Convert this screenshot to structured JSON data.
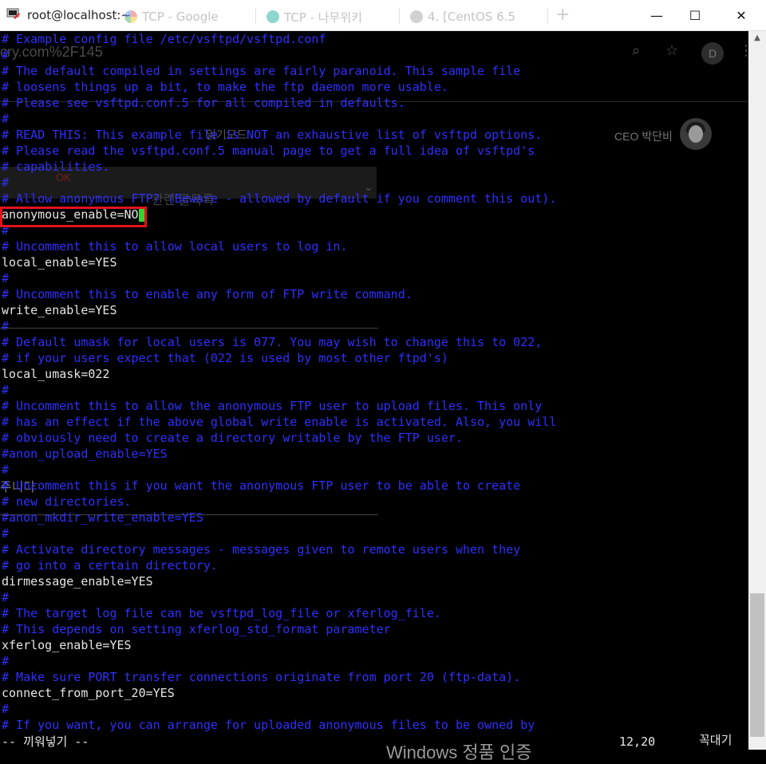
{
  "window": {
    "title": "root@localhost:~",
    "controls": {
      "minimize": "—",
      "maximize": "☐",
      "close": "✕"
    }
  },
  "tabs": [
    {
      "label": "TCP - Google",
      "icon": "google-icon",
      "color": "#4285f4"
    },
    {
      "label": "TCP - 나무위키",
      "icon": "namuwiki-icon",
      "color": "#00a495"
    },
    {
      "label": "4. [CentOS 6.5",
      "icon": "globe-icon",
      "color": "#888888"
    }
  ],
  "newtab_label": "+",
  "browser_ghost": {
    "url_fragment": "cry.com%2F145",
    "toolbar_text": "READ THIS:",
    "mode_text": "읽기모드",
    "user_name": "CEO 박단비",
    "avatar_initial": "D",
    "ok_label": "OK",
    "section_title": "관련 글목록",
    "footer_text": "주니다"
  },
  "terminal": {
    "lines": [
      {
        "text": "# Example config file /etc/vsftpd/vsftpd.conf",
        "kind": "comment"
      },
      {
        "text": "#",
        "kind": "comment"
      },
      {
        "text": "# The default compiled in settings are fairly paranoid. This sample file",
        "kind": "comment"
      },
      {
        "text": "# loosens things up a bit, to make the ftp daemon more usable.",
        "kind": "comment"
      },
      {
        "text": "# Please see vsftpd.conf.5 for all compiled in defaults.",
        "kind": "comment"
      },
      {
        "text": "#",
        "kind": "comment"
      },
      {
        "text": "# READ THIS: This example file is NOT an exhaustive list of vsftpd options.",
        "kind": "comment"
      },
      {
        "text": "# Please read the vsftpd.conf.5 manual page to get a full idea of vsftpd's",
        "kind": "comment"
      },
      {
        "text": "# capabilities.",
        "kind": "comment"
      },
      {
        "text": "#",
        "kind": "comment"
      },
      {
        "text": "# Allow anonymous FTP? (Beware - allowed by default if you comment this out).",
        "kind": "comment"
      },
      {
        "text": "anonymous_enable=NO",
        "kind": "setting",
        "cursor": true
      },
      {
        "text": "#",
        "kind": "comment"
      },
      {
        "text": "# Uncomment this to allow local users to log in.",
        "kind": "comment"
      },
      {
        "text": "local_enable=YES",
        "kind": "setting"
      },
      {
        "text": "#",
        "kind": "comment"
      },
      {
        "text": "# Uncomment this to enable any form of FTP write command.",
        "kind": "comment"
      },
      {
        "text": "write_enable=YES",
        "kind": "setting"
      },
      {
        "text": "#",
        "kind": "comment"
      },
      {
        "text": "# Default umask for local users is 077. You may wish to change this to 022,",
        "kind": "comment"
      },
      {
        "text": "# if your users expect that (022 is used by most other ftpd's)",
        "kind": "comment"
      },
      {
        "text": "local_umask=022",
        "kind": "setting"
      },
      {
        "text": "#",
        "kind": "comment"
      },
      {
        "text": "# Uncomment this to allow the anonymous FTP user to upload files. This only",
        "kind": "comment"
      },
      {
        "text": "# has an effect if the above global write enable is activated. Also, you will",
        "kind": "comment"
      },
      {
        "text": "# obviously need to create a directory writable by the FTP user.",
        "kind": "comment"
      },
      {
        "text": "#anon_upload_enable=YES",
        "kind": "comment"
      },
      {
        "text": "#",
        "kind": "comment"
      },
      {
        "text": "# Uncomment this if you want the anonymous FTP user to be able to create",
        "kind": "comment"
      },
      {
        "text": "# new directories.",
        "kind": "comment"
      },
      {
        "text": "#anon_mkdir_write_enable=YES",
        "kind": "comment"
      },
      {
        "text": "#",
        "kind": "comment"
      },
      {
        "text": "# Activate directory messages - messages given to remote users when they",
        "kind": "comment"
      },
      {
        "text": "# go into a certain directory.",
        "kind": "comment"
      },
      {
        "text": "dirmessage_enable=YES",
        "kind": "setting"
      },
      {
        "text": "#",
        "kind": "comment"
      },
      {
        "text": "# The target log file can be vsftpd_log_file or xferlog_file.",
        "kind": "comment"
      },
      {
        "text": "# This depends on setting xferlog_std_format parameter",
        "kind": "comment"
      },
      {
        "text": "xferlog_enable=YES",
        "kind": "setting"
      },
      {
        "text": "#",
        "kind": "comment"
      },
      {
        "text": "# Make sure PORT transfer connections originate from port 20 (ftp-data).",
        "kind": "comment"
      },
      {
        "text": "connect_from_port_20=YES",
        "kind": "setting"
      },
      {
        "text": "#",
        "kind": "comment"
      },
      {
        "text": "# If you want, you can arrange for uploaded anonymous files to be owned by",
        "kind": "comment"
      }
    ],
    "highlighted_line": "anonymous_enable=NO"
  },
  "status": {
    "mode": "-- 끼워넣기 --",
    "position": "12,20",
    "scroll": "꼭대기"
  },
  "watermark": "Windows 정품 인증",
  "colors": {
    "comment": "#3030ff",
    "setting": "#e6e6e6",
    "cursor": "#33d62b",
    "highlight_border": "#e0141b",
    "background": "#000000"
  }
}
